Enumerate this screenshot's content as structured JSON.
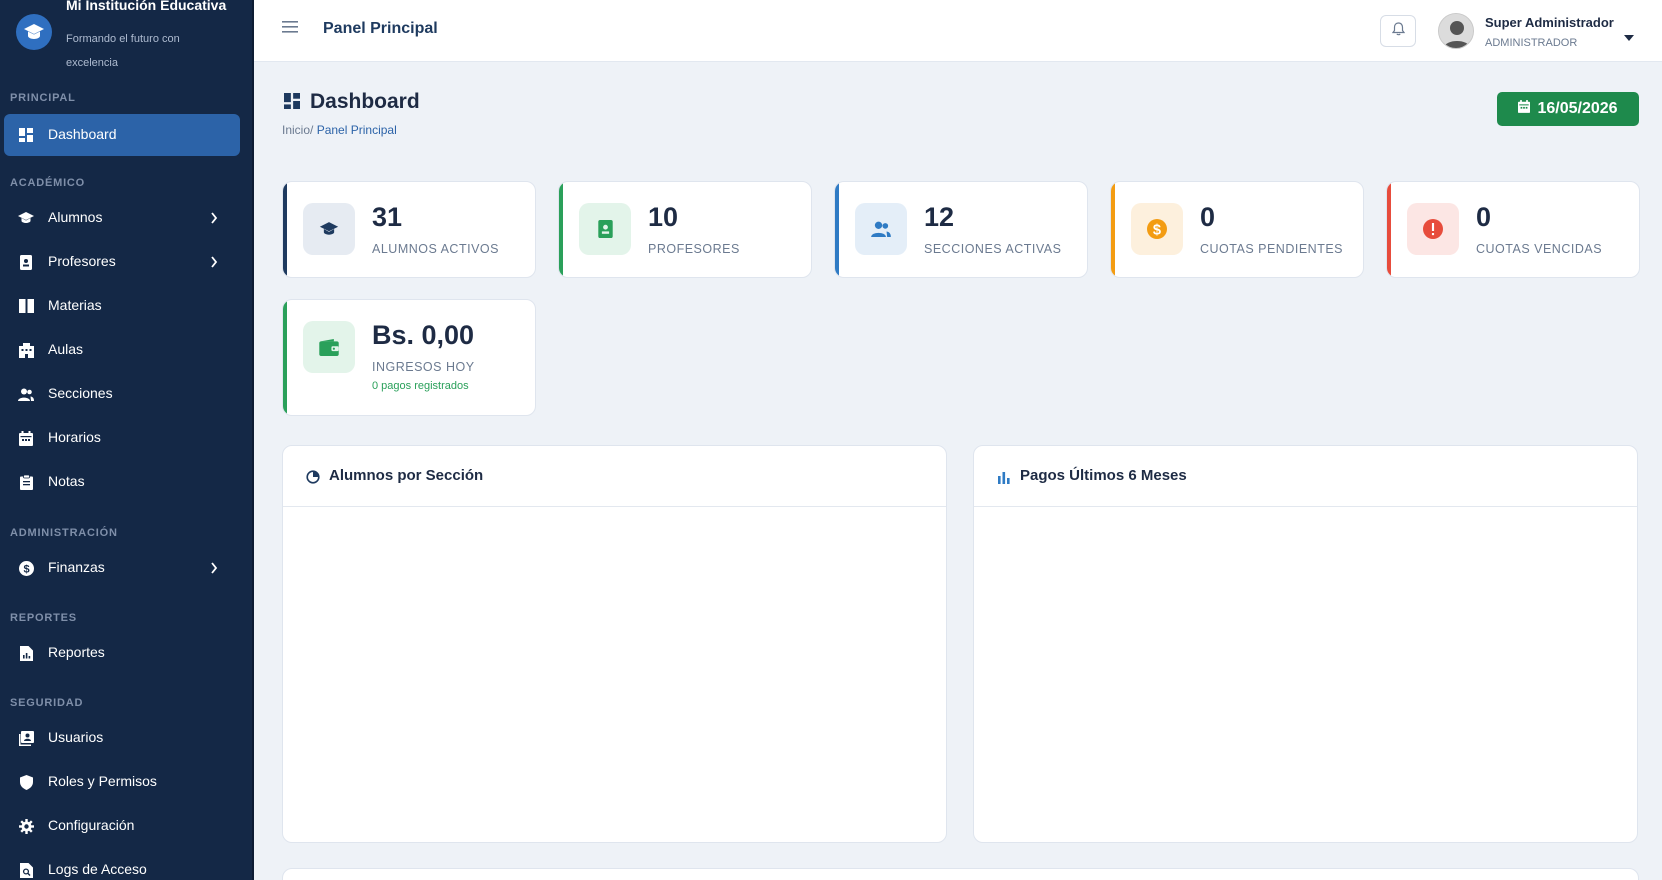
{
  "brand": {
    "title": "Mi Institución Educativa",
    "subtitle": "Formando el futuro con excelencia"
  },
  "sidebar": {
    "sections": [
      "PRINCIPAL",
      "ACADÉMICO",
      "ADMINISTRACIÓN",
      "REPORTES",
      "SEGURIDAD"
    ],
    "items": [
      {
        "label": "Dashboard",
        "icon": "dashboard-icon",
        "active": true
      },
      {
        "label": "Alumnos",
        "icon": "graduation-cap-icon",
        "has_submenu": true
      },
      {
        "label": "Profesores",
        "icon": "id-badge-icon",
        "has_submenu": true
      },
      {
        "label": "Materias",
        "icon": "book-icon"
      },
      {
        "label": "Aulas",
        "icon": "building-icon"
      },
      {
        "label": "Secciones",
        "icon": "users-icon"
      },
      {
        "label": "Horarios",
        "icon": "calendar-icon"
      },
      {
        "label": "Notas",
        "icon": "clipboard-icon"
      },
      {
        "label": "Finanzas",
        "icon": "dollar-circle-icon",
        "has_submenu": true
      },
      {
        "label": "Reportes",
        "icon": "report-file-icon"
      },
      {
        "label": "Usuarios",
        "icon": "user-card-icon"
      },
      {
        "label": "Roles y Permisos",
        "icon": "shield-icon"
      },
      {
        "label": "Configuración",
        "icon": "gear-icon"
      },
      {
        "label": "Logs de Acceso",
        "icon": "search-file-icon"
      }
    ]
  },
  "topbar": {
    "title": "Panel Principal",
    "user_name": "Super Administrador",
    "user_role": "ADMINISTRADOR"
  },
  "page": {
    "title": "Dashboard",
    "breadcrumb_home": "Inicio/",
    "breadcrumb_current": "Panel Principal",
    "date": "16/05/2026"
  },
  "stats": [
    {
      "value": "31",
      "label": "ALUMNOS ACTIVOS",
      "color": "#1e3a5f",
      "icon": "graduation-cap-icon"
    },
    {
      "value": "10",
      "label": "PROFESORES",
      "color": "#2aa05a",
      "icon": "id-badge-icon"
    },
    {
      "value": "12",
      "label": "SECCIONES ACTIVAS",
      "color": "#2f7bc4",
      "icon": "users-icon"
    },
    {
      "value": "0",
      "label": "CUOTAS PENDIENTES",
      "color": "#f39c12",
      "icon": "dollar-circle-icon"
    },
    {
      "value": "0",
      "label": "CUOTAS VENCIDAS",
      "color": "#e74c3c",
      "icon": "alert-circle-icon"
    },
    {
      "value": "Bs. 0,00",
      "label": "INGRESOS HOY",
      "sub": "0 pagos registrados",
      "color": "#2aa05a",
      "icon": "wallet-icon"
    }
  ],
  "panels": {
    "left_title": "Alumnos por Sección",
    "right_title": "Pagos Últimos 6 Meses"
  }
}
